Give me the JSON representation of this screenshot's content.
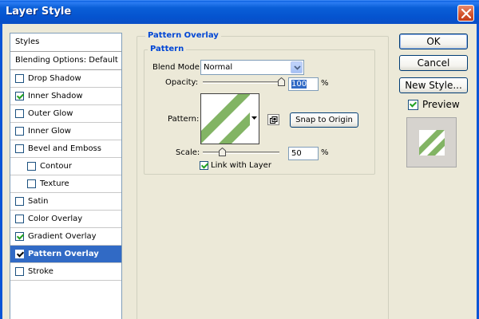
{
  "window": {
    "title": "Layer Style"
  },
  "styles_list": {
    "header": "Styles",
    "blending_options": "Blending Options: Default",
    "items": [
      {
        "label": "Drop Shadow",
        "checked": false,
        "indent": false,
        "selected": false
      },
      {
        "label": "Inner Shadow",
        "checked": true,
        "indent": false,
        "selected": false
      },
      {
        "label": "Outer Glow",
        "checked": false,
        "indent": false,
        "selected": false
      },
      {
        "label": "Inner Glow",
        "checked": false,
        "indent": false,
        "selected": false
      },
      {
        "label": "Bevel and Emboss",
        "checked": false,
        "indent": false,
        "selected": false
      },
      {
        "label": "Contour",
        "checked": false,
        "indent": true,
        "selected": false
      },
      {
        "label": "Texture",
        "checked": false,
        "indent": true,
        "selected": false
      },
      {
        "label": "Satin",
        "checked": false,
        "indent": false,
        "selected": false
      },
      {
        "label": "Color Overlay",
        "checked": false,
        "indent": false,
        "selected": false
      },
      {
        "label": "Gradient Overlay",
        "checked": true,
        "indent": false,
        "selected": false
      },
      {
        "label": "Pattern Overlay",
        "checked": true,
        "indent": false,
        "selected": true
      },
      {
        "label": "Stroke",
        "checked": false,
        "indent": false,
        "selected": false
      }
    ]
  },
  "pattern_overlay": {
    "group_title": "Pattern Overlay",
    "subgroup_title": "Pattern",
    "blend_mode_label": "Blend Mode:",
    "blend_mode_value": "Normal",
    "opacity_label": "Opacity:",
    "opacity_value": "100",
    "opacity_unit": "%",
    "pattern_label": "Pattern:",
    "snap_to_origin": "Snap to Origin",
    "scale_label": "Scale:",
    "scale_value": "50",
    "scale_unit": "%",
    "link_with_layer": "Link with Layer",
    "link_checked": true
  },
  "buttons": {
    "ok": "OK",
    "cancel": "Cancel",
    "new_style": "New Style...",
    "preview_label": "Preview",
    "preview_checked": true
  },
  "colors": {
    "pattern_green": "#82b464",
    "selection_blue": "#316ac5",
    "titlebar_blue": "#0a5fd8",
    "legend_blue": "#0046d5"
  }
}
